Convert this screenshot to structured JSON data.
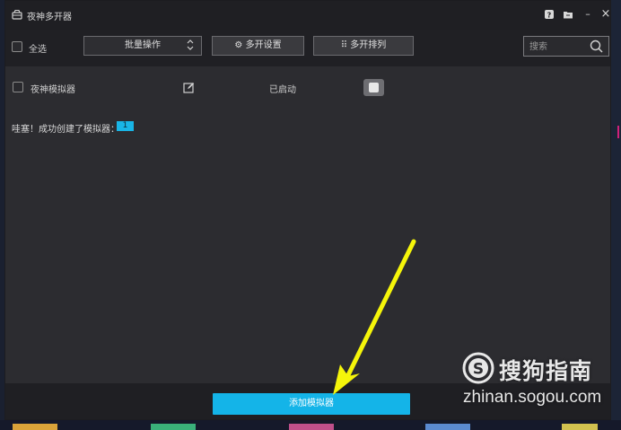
{
  "window": {
    "title": "夜神多开器",
    "help_icon": "help-icon",
    "folder_icon": "folder-icon",
    "minimize_label": "–",
    "close_label": "×"
  },
  "toolbar": {
    "select_all_label": "全选",
    "batch_label": "批量操作",
    "settings_label": "⚙ 多开设置",
    "arrange_label": "⠿ 多开排列",
    "search_placeholder": "搜索"
  },
  "emulators": [
    {
      "name": "夜神模拟器",
      "status": "已启动"
    }
  ],
  "message": {
    "text": "哇塞！成功创建了模拟器：",
    "count": "1"
  },
  "footer": {
    "add_label": "添加模拟器"
  },
  "watermark": {
    "brand": "搜狗指南",
    "url": "zhinan.sogou.com"
  },
  "colors": {
    "accent": "#14b4e8",
    "arrow": "#f5f50a"
  }
}
